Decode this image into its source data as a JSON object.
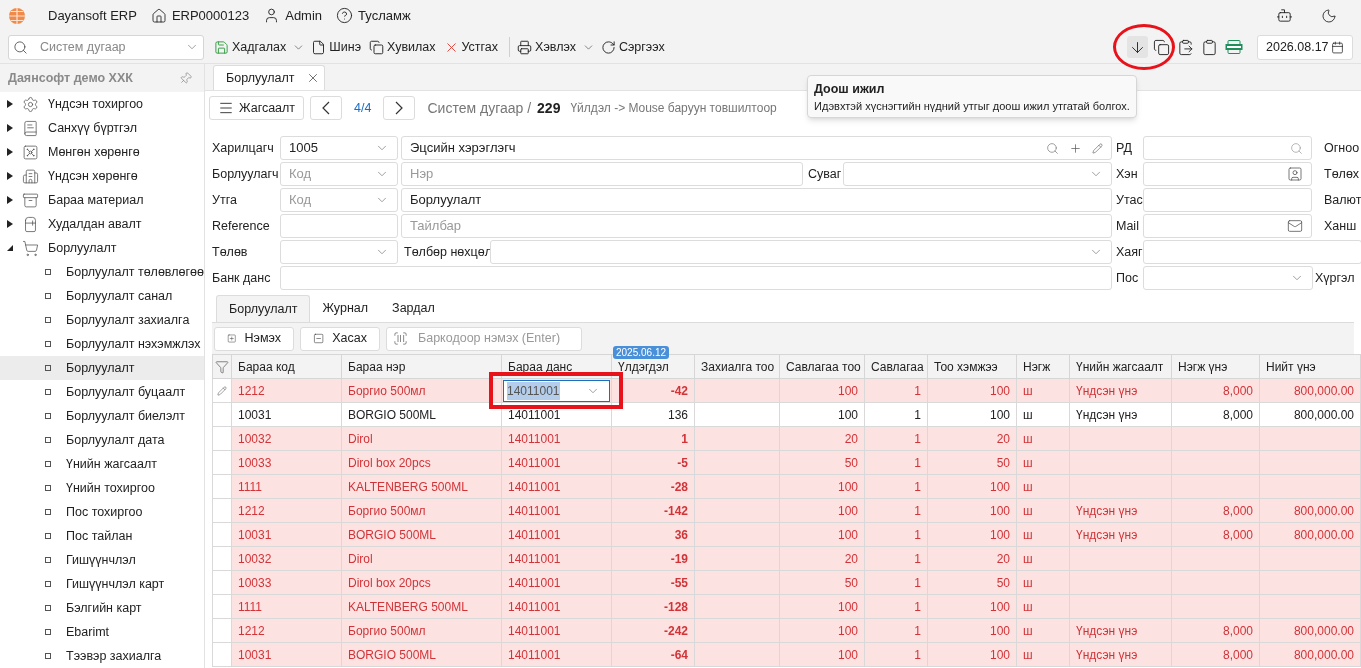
{
  "app": {
    "title": "Dayansoft ERP",
    "code": "ERP0000123",
    "user": "Admin",
    "help": "Тусламж"
  },
  "toolbar": {
    "search": {
      "placeholder": "Систем дугаар"
    },
    "actions": [
      {
        "kind": "save",
        "label": "Хадгалах",
        "menu": true
      },
      {
        "kind": "new",
        "label": "Шинэ",
        "menu": false
      },
      {
        "kind": "copy",
        "label": "Хувилах",
        "menu": false
      },
      {
        "kind": "delete",
        "label": "Устгах",
        "menu": false
      },
      {
        "kind": "print",
        "label": "Хэвлэх",
        "menu": true
      },
      {
        "kind": "refresh",
        "label": "Сэргээх",
        "menu": false
      }
    ],
    "tools": [
      {
        "kind": "down",
        "highlighted": true
      },
      {
        "kind": "copy",
        "highlighted": false
      },
      {
        "kind": "paste",
        "highlighted": false
      },
      {
        "kind": "clipboard",
        "highlighted": false
      },
      {
        "kind": "xlsx",
        "highlighted": false
      }
    ],
    "date": "2026.08.17"
  },
  "tooltip": {
    "title": "Доош ижил",
    "text": "Идэвхтэй хүснэгтийн нүдний утгыг доош ижил утгатай болгох."
  },
  "sidebar": {
    "company": "Даянсофт демо ХХК",
    "items": [
      {
        "label": "Үндсэн тохиргоо",
        "expanded": false
      },
      {
        "label": "Санхүү бүртгэл",
        "expanded": false
      },
      {
        "label": "Мөнгөн хөрөнгө",
        "expanded": false
      },
      {
        "label": "Үндсэн хөрөнгө",
        "expanded": false
      },
      {
        "label": "Бараа материал",
        "expanded": false
      },
      {
        "label": "Худалдан авалт",
        "expanded": false
      },
      {
        "label": "Борлуулалт",
        "expanded": true,
        "children": [
          {
            "label": "Борлуулалт төлөвлөгөө",
            "selected": false
          },
          {
            "label": "Борлуулалт санал",
            "selected": false
          },
          {
            "label": "Борлуулалт захиалга",
            "selected": false
          },
          {
            "label": "Борлуулалт нэхэмжлэх",
            "selected": false
          },
          {
            "label": "Борлуулалт",
            "selected": true
          },
          {
            "label": "Борлуулалт буцаалт",
            "selected": false
          },
          {
            "label": "Борлуулалт биелэлт",
            "selected": false
          },
          {
            "label": "Борлуулалт дата",
            "selected": false
          },
          {
            "label": "Үнийн жагсаалт",
            "selected": false
          },
          {
            "label": "Үнийн тохиргоо",
            "selected": false
          },
          {
            "label": "Пос тохиргоо",
            "selected": false
          },
          {
            "label": "Пос тайлан",
            "selected": false
          },
          {
            "label": "Гишүүнчлэл",
            "selected": false
          },
          {
            "label": "Гишүүнчлэл карт",
            "selected": false
          },
          {
            "label": "Бэлгийн карт",
            "selected": false
          },
          {
            "label": "Ebarimt",
            "selected": false
          },
          {
            "label": "Тээвэр захиалга",
            "selected": false
          }
        ]
      }
    ]
  },
  "document_tab": {
    "label": "Борлуулалт"
  },
  "nav": {
    "list_button": "Жагсаалт",
    "position": "4/4",
    "system_label": "Систем дугаар /",
    "number": "229",
    "hint": "Үйлдэл -> Mouse баруун товшилтоор"
  },
  "form": {
    "customer": {
      "label": "Харилцагч",
      "code": "1005",
      "name": "Эцсийн хэрэглэгч"
    },
    "seller": {
      "label": "Борлуулагч",
      "code_placeholder": "Код",
      "name_placeholder": "Нэр"
    },
    "channel": {
      "label": "Суваг"
    },
    "purpose": {
      "label": "Утга",
      "code_placeholder": "Код",
      "value": "Борлуулалт"
    },
    "reference": {
      "label": "Reference",
      "note_placeholder": "Тайлбар"
    },
    "status": {
      "label": "Төлөв"
    },
    "payment_terms": {
      "label": "Төлбөр нөхцөл"
    },
    "bank_account": {
      "label": "Банк данс"
    },
    "right": [
      {
        "label": "РД",
        "side_label": "Огноо"
      },
      {
        "label": "Хэн",
        "side_label": "Төлөх"
      },
      {
        "label": "Утас",
        "side_label": "Валют"
      },
      {
        "label": "Mail",
        "side_label": "Ханш"
      },
      {
        "label": "Хаяг"
      },
      {
        "label": "Пос",
        "side_label": "Хүргэл"
      }
    ]
  },
  "subtabs": [
    {
      "label": "Борлуулалт",
      "selected": true
    },
    {
      "label": "Журнал",
      "selected": false
    },
    {
      "label": "Зардал",
      "selected": false
    }
  ],
  "grid_actions": {
    "add": "Нэмэх",
    "remove": "Хасах",
    "barcode_placeholder": "Баркодоор нэмэх (Enter)"
  },
  "table": {
    "columns": [
      {
        "label": "Бараа код"
      },
      {
        "label": "Бараа нэр"
      },
      {
        "label": "Бараа данс"
      },
      {
        "label": "Үлдэгдэл",
        "badge": "2025.06.12"
      },
      {
        "label": "Захиалга тоо"
      },
      {
        "label": "Савлагаа тоо"
      },
      {
        "label": "Савлагаа"
      },
      {
        "label": "Тоо хэмжээ"
      },
      {
        "label": "Нэгж"
      },
      {
        "label": "Үнийн жагсаалт"
      },
      {
        "label": "Нэгж үнэ"
      },
      {
        "label": "Нийт үнэ"
      }
    ],
    "rows": [
      {
        "error": true,
        "editing": true,
        "annotated": true,
        "cells": [
          "1212",
          "Боргио 500мл",
          "14011001",
          "-42",
          null,
          "100",
          "1",
          "100",
          "ш",
          "Үндсэн үнэ",
          "8,000",
          "800,000.00"
        ]
      },
      {
        "error": false,
        "editing": false,
        "cells": [
          "10031",
          "BORGIO 500ML",
          "14011001",
          "136",
          null,
          "100",
          "1",
          "100",
          "ш",
          "Үндсэн үнэ",
          "8,000",
          "800,000.00"
        ]
      },
      {
        "error": true,
        "editing": false,
        "cells": [
          "10032",
          "Dirol",
          "14011001",
          "1",
          null,
          "20",
          "1",
          "20",
          "ш",
          null,
          null,
          null
        ]
      },
      {
        "error": true,
        "editing": false,
        "cells": [
          "10033",
          "Dirol box 20pcs",
          "14011001",
          "-5",
          null,
          "50",
          "1",
          "50",
          "ш",
          null,
          null,
          null
        ]
      },
      {
        "error": true,
        "editing": false,
        "cells": [
          "1111",
          "KALTENBERG 500ML",
          "14011001",
          "-28",
          null,
          "100",
          "1",
          "100",
          "ш",
          null,
          null,
          null
        ]
      },
      {
        "error": true,
        "editing": false,
        "cells": [
          "1212",
          "Боргио 500мл",
          "14011001",
          "-142",
          null,
          "100",
          "1",
          "100",
          "ш",
          "Үндсэн үнэ",
          "8,000",
          "800,000.00"
        ]
      },
      {
        "error": true,
        "editing": false,
        "cells": [
          "10031",
          "BORGIO 500ML",
          "14011001",
          "36",
          null,
          "100",
          "1",
          "100",
          "ш",
          "Үндсэн үнэ",
          "8,000",
          "800,000.00"
        ]
      },
      {
        "error": true,
        "editing": false,
        "cells": [
          "10032",
          "Dirol",
          "14011001",
          "-19",
          null,
          "20",
          "1",
          "20",
          "ш",
          null,
          null,
          null
        ]
      },
      {
        "error": true,
        "editing": false,
        "cells": [
          "10033",
          "Dirol box 20pcs",
          "14011001",
          "-55",
          null,
          "50",
          "1",
          "50",
          "ш",
          null,
          null,
          null
        ]
      },
      {
        "error": true,
        "editing": false,
        "cells": [
          "1111",
          "KALTENBERG 500ML",
          "14011001",
          "-128",
          null,
          "100",
          "1",
          "100",
          "ш",
          null,
          null,
          null
        ]
      },
      {
        "error": true,
        "editing": false,
        "cells": [
          "1212",
          "Боргио 500мл",
          "14011001",
          "-242",
          null,
          "100",
          "1",
          "100",
          "ш",
          "Үндсэн үнэ",
          "8,000",
          "800,000.00"
        ]
      },
      {
        "error": true,
        "editing": false,
        "cells": [
          "10031",
          "BORGIO 500ML",
          "14011001",
          "-64",
          null,
          "100",
          "1",
          "100",
          "ш",
          "Үндсэн үнэ",
          "8,000",
          "800,000.00"
        ]
      }
    ]
  }
}
